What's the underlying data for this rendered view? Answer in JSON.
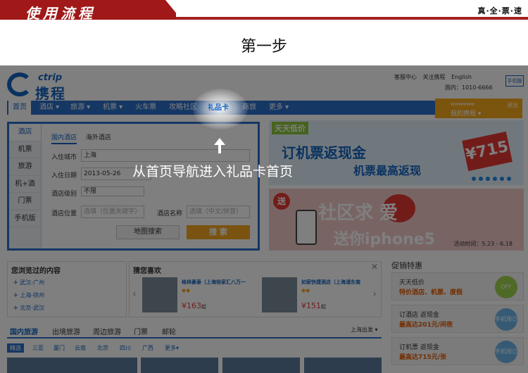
{
  "header": {
    "title": "使用流程",
    "right_label": "真·全·票·速"
  },
  "step_label": "第一步",
  "instruction": "从首页导航进入礼品卡首页",
  "site": {
    "logo_en": "ctrip",
    "logo_cn": "携程",
    "top_links": [
      "客服中心",
      "关注携程",
      "English"
    ],
    "hotline": "国内：1010-6666",
    "mobile_label": "手机版",
    "nav": [
      {
        "label": "首页",
        "active": true
      },
      {
        "label": "酒店 ▾"
      },
      {
        "label": "旅游 ▾"
      },
      {
        "label": "机票 ▾"
      },
      {
        "label": "火车票"
      },
      {
        "label": "攻略社区"
      },
      {
        "label": "礼品卡",
        "highlight": true
      },
      {
        "label": "商旅"
      },
      {
        "label": "更多 ▾"
      }
    ],
    "user": {
      "greeting": "wwwwww",
      "my_ctrip": "我的携程 ▾",
      "logout": "退出"
    }
  },
  "search": {
    "side_tabs": [
      "酒店",
      "机票",
      "旅游",
      "机+酒",
      "门票",
      "手机版"
    ],
    "sub_tabs": [
      "国内酒店",
      "海外酒店"
    ],
    "city_label": "入住城市",
    "city_value": "上海",
    "date_label": "入住日期",
    "date_value": "2013-05-26",
    "level_label": "酒店级别",
    "level_value": "不限",
    "location_label": "酒店位置",
    "location_placeholder": "选填（位置关键字）",
    "name_label": "酒店名称",
    "name_placeholder": "选填（中文/拼音）",
    "map_button": "地图搜索",
    "search_button": "搜 索"
  },
  "banner1": {
    "tag": "天天低价",
    "main": "订机票返现金",
    "sub": "机票最高返现",
    "price": "¥715"
  },
  "banner2": {
    "tag": "送",
    "main": "社区求  爱",
    "sub": "送你iphone5",
    "time": "活动时间：5.23 - 6.18"
  },
  "recent": {
    "title": "您浏览过的内容",
    "items": [
      "武汉-广州",
      "上海-徐州",
      "北京-武汉"
    ]
  },
  "guess": {
    "title": "猜您喜欢",
    "hotels": [
      {
        "name": "格林豪泰（上海徐家汇八万一",
        "price": "¥163",
        "suffix": "起"
      },
      {
        "name": "如家快捷酒店（上海浦东南",
        "price": "¥151",
        "suffix": "起"
      }
    ]
  },
  "promo": {
    "title": "促销特惠",
    "cards": [
      {
        "line1": "天天低价",
        "line2": "特价酒店、机票、度假",
        "badge": "OFF"
      },
      {
        "line1": "订酒店 返现金",
        "line2": "最高达201元/间夜",
        "badge": "手机预订"
      },
      {
        "line1": "订机票 返现金",
        "line2": "最高达715元/张",
        "badge": "手机预订"
      }
    ]
  },
  "travel_tabs": [
    "国内旅游",
    "出境旅游",
    "周边旅游",
    "门票",
    "邮轮"
  ],
  "departure": "上海出发 ▾",
  "cities": [
    "精选",
    "三亚",
    "厦门",
    "云南",
    "北京",
    "四川",
    "广西",
    "更多▾"
  ],
  "colors": {
    "brand_blue": "#2a6fc9",
    "header_red": "#a01818",
    "accent_orange": "#f5a623"
  }
}
